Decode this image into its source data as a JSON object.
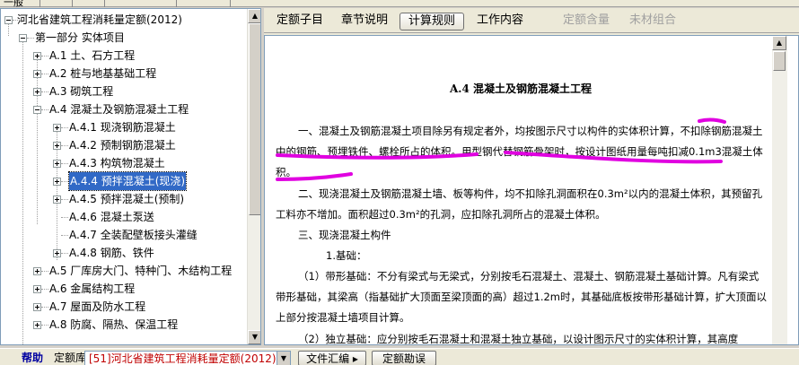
{
  "top_strip": {
    "labels": [
      "一般",
      "",
      ""
    ]
  },
  "tree": {
    "items": [
      {
        "label": "河北省建筑工程消耗量定额(2012)",
        "level": 0,
        "expander": "minus"
      },
      {
        "label": "第一部分 实体项目",
        "level": 1,
        "expander": "minus"
      },
      {
        "label": "A.1 土、石方工程",
        "level": 2,
        "expander": "plus"
      },
      {
        "label": "A.2 桩与地基基础工程",
        "level": 2,
        "expander": "plus"
      },
      {
        "label": "A.3 砌筑工程",
        "level": 2,
        "expander": "plus"
      },
      {
        "label": "A.4 混凝土及钢筋混凝土工程",
        "level": 2,
        "expander": "minus"
      },
      {
        "label": "A.4.1 现浇钢筋混凝土",
        "level": 3,
        "expander": "plus"
      },
      {
        "label": "A.4.2 预制钢筋混凝土",
        "level": 3,
        "expander": "plus"
      },
      {
        "label": "A.4.3 构筑物混凝土",
        "level": 3,
        "expander": "plus"
      },
      {
        "label": "A.4.4 预拌混凝土(现浇)",
        "level": 3,
        "expander": "plus",
        "selected": true
      },
      {
        "label": "A.4.5 预拌混凝土(预制)",
        "level": 3,
        "expander": "plus"
      },
      {
        "label": "A.4.6 混凝土泵送",
        "level": 3,
        "expander": "none"
      },
      {
        "label": "A.4.7 全装配壁板接头灌缝",
        "level": 3,
        "expander": "none"
      },
      {
        "label": "A.4.8 钢筋、铁件",
        "level": 3,
        "expander": "plus"
      },
      {
        "label": "A.5 厂库房大门、特种门、木结构工程",
        "level": 2,
        "expander": "plus"
      },
      {
        "label": "A.6 金属结构工程",
        "level": 2,
        "expander": "plus"
      },
      {
        "label": "A.7 屋面及防水工程",
        "level": 2,
        "expander": "plus"
      },
      {
        "label": "A.8 防腐、隔热、保温工程",
        "level": 2,
        "expander": "plus"
      }
    ]
  },
  "tabs": [
    {
      "label": "定额子目",
      "state": "normal"
    },
    {
      "label": "章节说明",
      "state": "normal"
    },
    {
      "label": "计算规则",
      "state": "active"
    },
    {
      "label": "工作内容",
      "state": "normal"
    },
    {
      "label": "定额含量",
      "state": "disabled"
    },
    {
      "label": "未材组合",
      "state": "disabled"
    }
  ],
  "document": {
    "title": "A.4  混凝土及钢筋混凝土工程",
    "paragraphs": [
      "一、混凝土及钢筋混凝土项目除另有规定者外，均按图示尺寸以构件的实体积计算，不扣除钢筋混凝土中的钢筋、预埋铁件、螺栓所占的体积。用型钢代替钢筋骨架时，按设计图纸用量每吨扣减0.1m3混凝土体积。",
      "二、现浇混凝土及钢筋混凝土墙、板等构件，均不扣除孔洞面积在0.3m²以内的混凝土体积，其预留孔工料亦不增加。面积超过0.3m²的孔洞，应扣除孔洞所占的混凝土体积。",
      "三、现浇混凝土构件",
      "1.基础：",
      "（1）带形基础：不分有梁式与无梁式，分别按毛石混凝土、混凝土、钢筋混凝土基础计算。凡有梁式带形基础，其梁高（指基础扩大顶面至梁顶面的高）超过1.2m时，其基础底板按带形基础计算，扩大顶面以上部分按混凝土墙项目计算。",
      "（2）独立基础：应分别按毛石混凝土和混凝土独立基础，以设计图示尺寸的实体积计算，其高度"
    ]
  },
  "annotation_color": "#e000e0",
  "bottom_bar": {
    "help_label": "帮助",
    "quota_label": "定额库:",
    "quota_value": "[51]河北省建筑工程消耗量定额(2012)",
    "file_button": "文件汇编 ▸",
    "errata_button": "定额勘误"
  }
}
